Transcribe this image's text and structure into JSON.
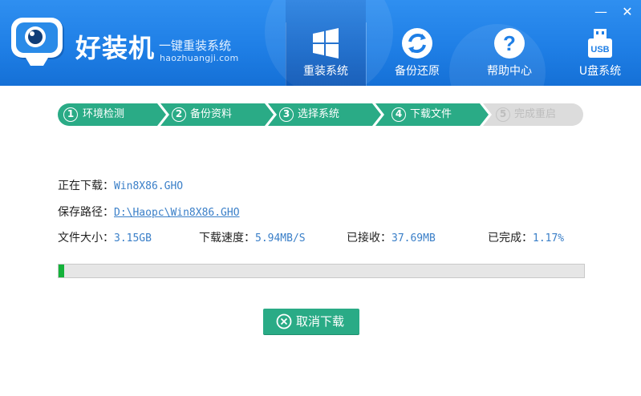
{
  "header": {
    "brand_name": "好装机",
    "brand_slogan": "一键重装系统",
    "brand_url": "haozhuangji.com",
    "nav": [
      {
        "label": "重装系统",
        "icon": "windows-icon",
        "active": true
      },
      {
        "label": "备份还原",
        "icon": "refresh-icon",
        "active": false
      },
      {
        "label": "帮助中心",
        "icon": "help-icon",
        "active": false
      },
      {
        "label": "U盘系统",
        "icon": "usb-icon",
        "active": false
      }
    ],
    "usb_icon_text": "USB",
    "window_controls": {
      "minimize": "—",
      "close": "✕"
    }
  },
  "steps": [
    {
      "num": "1",
      "label": "环境检测",
      "state": "done"
    },
    {
      "num": "2",
      "label": "备份资料",
      "state": "done"
    },
    {
      "num": "3",
      "label": "选择系统",
      "state": "done"
    },
    {
      "num": "4",
      "label": "下载文件",
      "state": "active"
    },
    {
      "num": "5",
      "label": "完成重启",
      "state": "pending"
    }
  ],
  "download": {
    "downloading_label": "正在下载：",
    "downloading_value": "Win8X86.GHO",
    "path_label": "保存路径：",
    "path_value": "D:\\Haopc\\Win8X86.GHO",
    "size_label": "文件大小：",
    "size_value": "3.15GB",
    "speed_label": "下载速度：",
    "speed_value": "5.94MB/S",
    "received_label": "已接收：",
    "received_value": "37.69MB",
    "done_label": "已完成：",
    "done_value": "1.17%",
    "progress_fraction": 0.0117
  },
  "cancel_button": {
    "label": "取消下载"
  },
  "colors": {
    "header_blue": "#1f7fe6",
    "step_green": "#2aab86",
    "step_pending": "#dcdcdc",
    "progress_green": "#14b23a",
    "value_blue": "#3a7fc8"
  }
}
